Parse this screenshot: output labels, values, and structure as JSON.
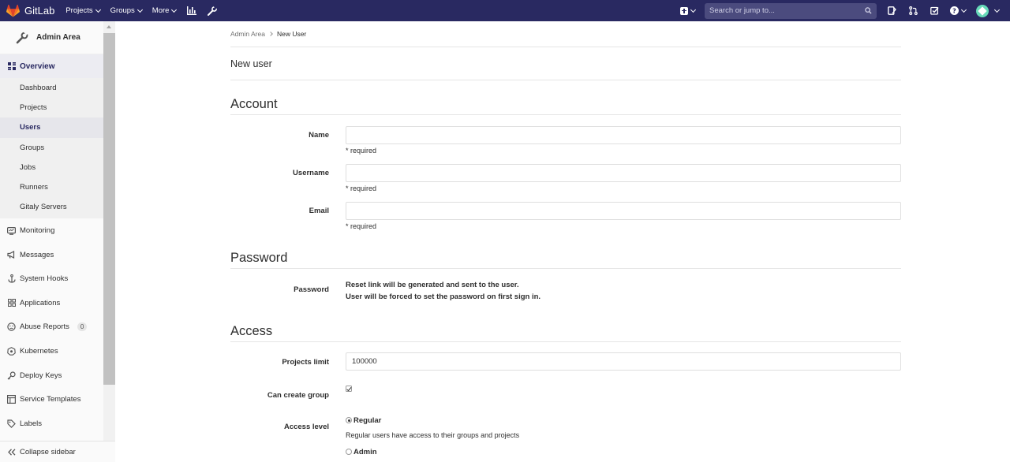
{
  "navbar": {
    "brand": "GitLab",
    "links": [
      "Projects",
      "Groups",
      "More"
    ],
    "search_placeholder": "Search or jump to...",
    "brand_color": "#292961"
  },
  "sidebar": {
    "header": "Admin Area",
    "overview": "Overview",
    "sub_items": [
      "Dashboard",
      "Projects",
      "Users",
      "Groups",
      "Jobs",
      "Runners",
      "Gitaly Servers"
    ],
    "active_sub_item": "Users",
    "items": [
      {
        "label": "Monitoring",
        "icon": "monitor-icon"
      },
      {
        "label": "Messages",
        "icon": "megaphone-icon"
      },
      {
        "label": "System Hooks",
        "icon": "anchor-icon"
      },
      {
        "label": "Applications",
        "icon": "grid-icon"
      },
      {
        "label": "Abuse Reports",
        "icon": "abuse-icon",
        "badge": "0"
      },
      {
        "label": "Kubernetes",
        "icon": "kubernetes-icon"
      },
      {
        "label": "Deploy Keys",
        "icon": "key-icon"
      },
      {
        "label": "Service Templates",
        "icon": "template-icon"
      },
      {
        "label": "Labels",
        "icon": "label-icon"
      }
    ],
    "collapse": "Collapse sidebar"
  },
  "breadcrumb": {
    "parent": "Admin Area",
    "current": "New User"
  },
  "page_title": "New user",
  "account": {
    "title": "Account",
    "name_label": "Name",
    "username_label": "Username",
    "email_label": "Email",
    "required_hint": "* required"
  },
  "password": {
    "title": "Password",
    "label": "Password",
    "line1": "Reset link will be generated and sent to the user.",
    "line2": "User will be forced to set the password on first sign in."
  },
  "access": {
    "title": "Access",
    "projects_limit_label": "Projects limit",
    "projects_limit_value": "100000",
    "can_create_group_label": "Can create group",
    "access_level_label": "Access level",
    "regular_label": "Regular",
    "regular_desc": "Regular users have access to their groups and projects",
    "admin_label": "Admin"
  }
}
